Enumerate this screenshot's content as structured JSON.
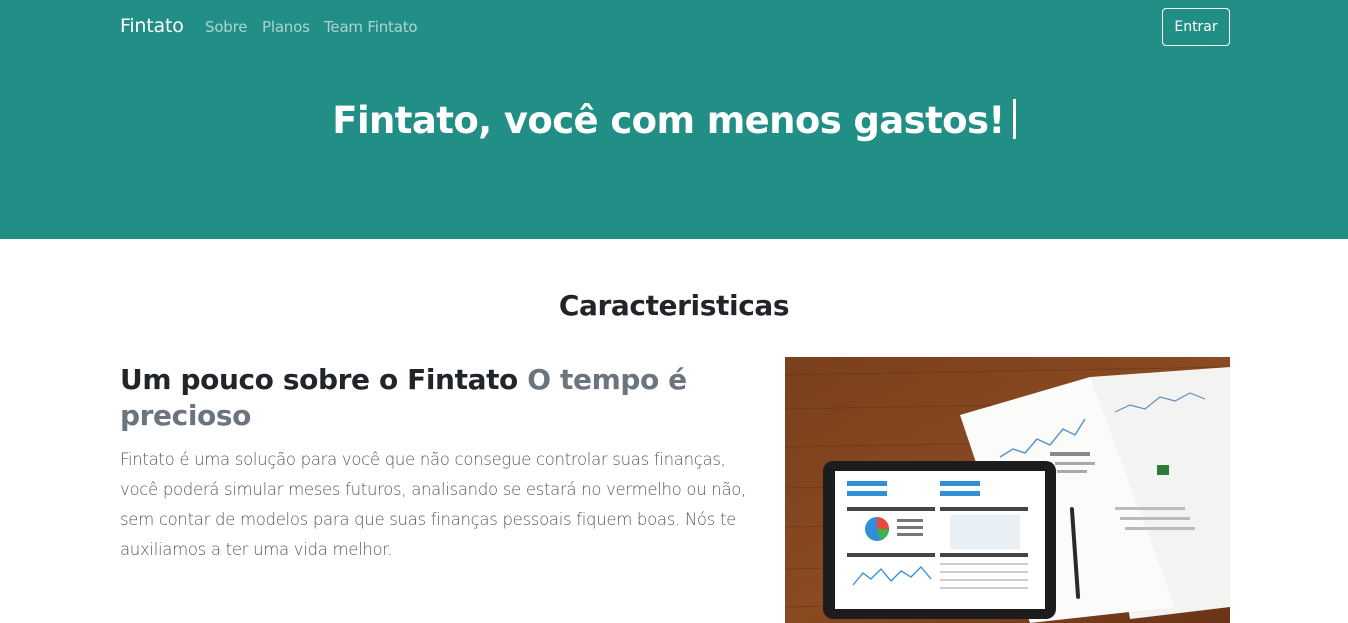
{
  "navbar": {
    "brand": "Fintato",
    "links": [
      "Sobre",
      "Planos",
      "Team Fintato"
    ],
    "login_label": "Entrar"
  },
  "hero": {
    "title": "Fintato, você com menos gastos!"
  },
  "section": {
    "title": "Caracteristicas"
  },
  "feature": {
    "heading": "Um pouco sobre o Fintato",
    "subheading": "O tempo é precioso",
    "text": "Fintato é uma solução para você que não consegue controlar suas finanças, você poderá simular meses futuros, analisando se estará no vermelho ou não, sem contar de modelos para que suas finanças pessoais fiquem boas. Nós te auxiliamos a ter uma vida melhor."
  },
  "colors": {
    "hero_bg": "#218f85",
    "muted_text": "#6c757d"
  }
}
